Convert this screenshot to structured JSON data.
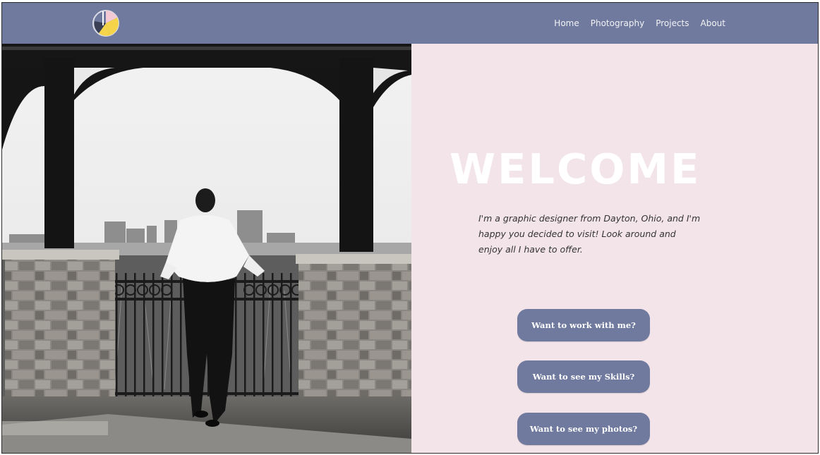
{
  "header": {
    "logo_icon": "pie-logo-icon",
    "nav": {
      "home": "Home",
      "photography": "Photography",
      "projects": "Projects",
      "about": "About"
    },
    "background": "#6f7a9e"
  },
  "hero": {
    "photo": "black-and-white photo of a person at a gazebo railing overlooking a city skyline",
    "title": "WELCOME",
    "intro": "I'm a graphic designer from Dayton, Ohio, and I'm happy you decided to visit! Look around and enjoy all I have to offer.",
    "buttons": {
      "work": "Want to work with me?",
      "skills": "Want to see my Skills?",
      "photos": "Want to see my photos?"
    },
    "background": "#f3e4ea",
    "button_color": "#6f7a9e"
  }
}
